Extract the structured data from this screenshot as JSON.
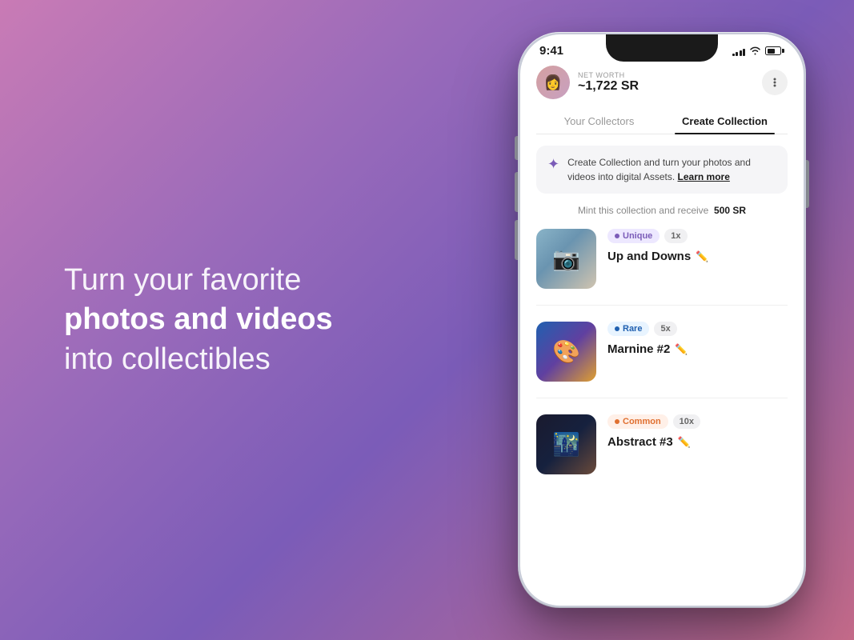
{
  "background": {
    "gradient_start": "#c97bb5",
    "gradient_end": "#7b5cb8"
  },
  "left_section": {
    "headline_line1": "Turn your favorite",
    "headline_bold": "photos and videos",
    "headline_line3": "into collectibles"
  },
  "phone": {
    "status_bar": {
      "time": "9:41",
      "signal_bars": [
        4,
        6,
        8,
        11,
        13
      ],
      "wifi": true,
      "battery": true
    },
    "profile": {
      "net_worth_label": "NET WORTH",
      "net_worth_value": "~1,722 SR",
      "avatar_emoji": "👩"
    },
    "tabs": [
      {
        "label": "Your Collectors",
        "active": false
      },
      {
        "label": "Create Collection",
        "active": true
      }
    ],
    "info_banner": {
      "icon": "✦",
      "text": "Create Collection and turn your photos and videos into digital Assets.",
      "link_text": "Learn more"
    },
    "mint_label": {
      "prefix": "Mint this collection and receive",
      "amount": "500 SR"
    },
    "collection_items": [
      {
        "badge_type": "unique",
        "badge_label": "Unique",
        "count": "1x",
        "name": "Up and Downs",
        "thumb_type": "person-camera"
      },
      {
        "badge_type": "rare",
        "badge_label": "Rare",
        "count": "5x",
        "name": "Marnine #2",
        "thumb_type": "colorful-person"
      },
      {
        "badge_type": "common",
        "badge_label": "Common",
        "count": "10x",
        "name": "Abstract #3",
        "thumb_type": "dark-crowd"
      }
    ]
  }
}
